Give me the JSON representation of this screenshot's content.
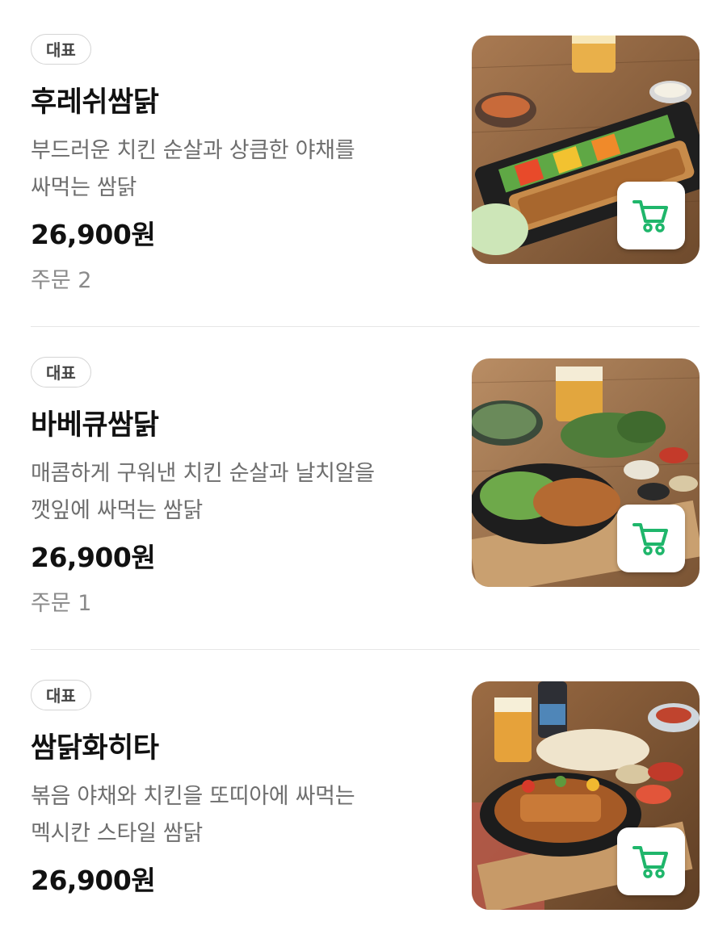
{
  "menu": {
    "items": [
      {
        "badge": "대표",
        "name": "후레쉬쌈닭",
        "desc_line1": "부드러운 치킨 순살과 상큼한 야채를",
        "desc_line2": "싸먹는 쌈닭",
        "price": "26,900원",
        "orders": "주문 2",
        "image_icon": "food-photo",
        "cart_icon": "cart-icon"
      },
      {
        "badge": "대표",
        "name": "바베큐쌈닭",
        "desc_line1": "매콤하게 구워낸 치킨 순살과 날치알을",
        "desc_line2": "깻잎에 싸먹는 쌈닭",
        "price": "26,900원",
        "orders": "주문 1",
        "image_icon": "food-photo",
        "cart_icon": "cart-icon"
      },
      {
        "badge": "대표",
        "name": "쌈닭화히타",
        "desc_line1": "볶음 야채와 치킨을 또띠아에 싸먹는",
        "desc_line2": "멕시칸 스타일 쌈닭",
        "price": "26,900원",
        "image_icon": "food-photo",
        "cart_icon": "cart-icon"
      }
    ]
  },
  "colors": {
    "cart_green": "#1fb66b",
    "divider": "#e6e6e6",
    "desc_gray": "#6e6e6e",
    "wood": "#8a5a34"
  }
}
